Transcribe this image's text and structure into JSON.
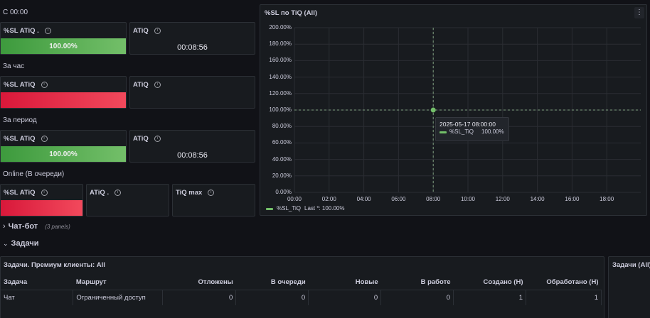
{
  "sections": {
    "s1_title": "С 00:00",
    "s2_title": "За час",
    "s3_title": "За период",
    "s4_title": "Online (В очереди)"
  },
  "s1": {
    "p1_title": "%SL ATiQ .",
    "p1_value": "100.00%",
    "p2_title": "ATiQ",
    "p2_value": "00:08:56"
  },
  "s2": {
    "p1_title": "%SL ATiQ",
    "p2_title": "ATiQ"
  },
  "s3": {
    "p1_title": "%SL ATiQ",
    "p1_value": "100.00%",
    "p2_title": "ATiQ",
    "p2_value": "00:08:56"
  },
  "s4": {
    "p1_title": "%SL ATiQ",
    "p2_title": "ATiQ .",
    "p3_title": "TiQ max"
  },
  "info_glyph": "i",
  "menu_glyph": "⋮",
  "chart_panel": {
    "title": "%SL по TiQ (All)",
    "tooltip_time": "2025-05-17 08:00:00",
    "tooltip_series": "%SL_TiQ",
    "tooltip_value": "100.00%",
    "legend_series": "%SL_TiQ",
    "legend_last": "Last *: 100.00%"
  },
  "chart_data": {
    "type": "line",
    "title": "%SL по TiQ (All)",
    "x_ticks": [
      "00:00",
      "02:00",
      "04:00",
      "06:00",
      "08:00",
      "10:00",
      "12:00",
      "14:00",
      "16:00",
      "18:00"
    ],
    "y_ticks": [
      "0.00%",
      "20.00%",
      "40.00%",
      "60.00%",
      "80.00%",
      "100.00%",
      "120.00%",
      "140.00%",
      "160.00%",
      "180.00%",
      "200.00%"
    ],
    "ylim": [
      0,
      200
    ],
    "series": [
      {
        "name": "%SL_TiQ",
        "color": "#73bf69",
        "points": [
          {
            "x": "08:00",
            "y": 100
          }
        ]
      }
    ],
    "grid": true,
    "legend_position": "bottom-left"
  },
  "collapsed_row": {
    "chevron": "›",
    "title": "Чат-бот",
    "note": "(3 panels)"
  },
  "open_row": {
    "chevron": "⌄",
    "title": "Задачи"
  },
  "table_panel": {
    "title": "Задачи. Премиум клиенты: All",
    "columns": [
      "Задача",
      "Маршрут",
      "Отложены",
      "В очереди",
      "Новые",
      "В работе",
      "Создано (Н)",
      "Обработано (Н)"
    ],
    "rows": [
      [
        "Чат",
        "Ограниченный доступ",
        "0",
        "0",
        "0",
        "0",
        "1",
        "1"
      ]
    ]
  },
  "side_panel": {
    "title": "Задачи (All)"
  },
  "colors": {
    "background": "#111217",
    "panel": "#181b1f",
    "green": "#73bf69",
    "red": "#f2495c"
  }
}
